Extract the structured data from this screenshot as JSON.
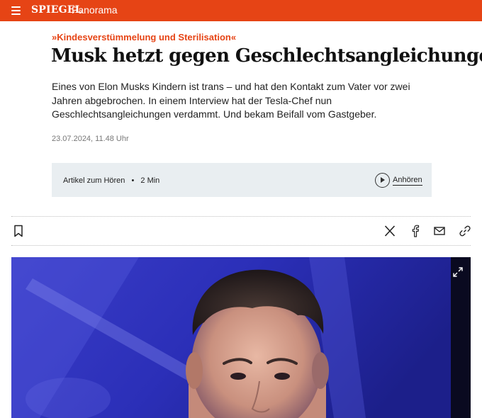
{
  "header": {
    "logo_text": "SPIEGEL",
    "section": "Panorama",
    "brand_color": "#e64415",
    "menu_icon": "hamburger-menu-icon"
  },
  "article": {
    "kicker": "»Kindesverstümmelung und Sterilisation«",
    "headline": "Musk hetzt gegen Geschlechtsangleichungen",
    "teaser": "Eines von Elon Musks Kindern ist trans – und hat den Kontakt zum Vater vor zwei Jahren abgebrochen. In einem Interview hat der Tesla-Chef nun Geschlechtsangleichungen verdammt. Und bekam Beifall vom Gastgeber.",
    "date": "23.07.2024, 11.48 Uhr"
  },
  "audio": {
    "label": "Artikel zum Hören",
    "separator": "•",
    "duration": "2 Min",
    "action": "Anhören"
  },
  "toolbar": {
    "icons": [
      "bookmark-icon",
      "x-share-icon",
      "facebook-share-icon",
      "mail-share-icon",
      "link-share-icon"
    ]
  },
  "hero": {
    "icon": "expand-icon"
  }
}
